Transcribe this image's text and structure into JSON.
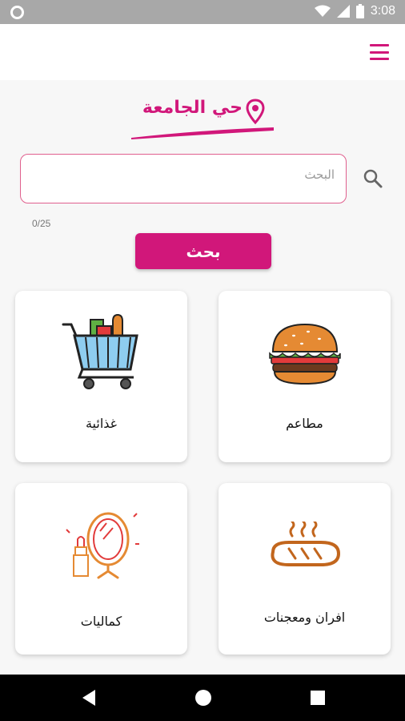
{
  "status_bar": {
    "time": "3:08"
  },
  "header": {
    "logo_text": "حي الجامعة"
  },
  "search": {
    "placeholder": "البحث",
    "counter": "0/25",
    "button_label": "بحث"
  },
  "categories": [
    {
      "label": "مطاعم",
      "icon": "burger-icon"
    },
    {
      "label": "غذائية",
      "icon": "shopping-cart-icon"
    },
    {
      "label": "افران ومعجنات",
      "icon": "bread-icon"
    },
    {
      "label": "كماليات",
      "icon": "mirror-lipstick-icon"
    }
  ],
  "colors": {
    "accent": "#d1177a",
    "status_bar": "#a8a8a8",
    "nav_bar": "#000000"
  }
}
